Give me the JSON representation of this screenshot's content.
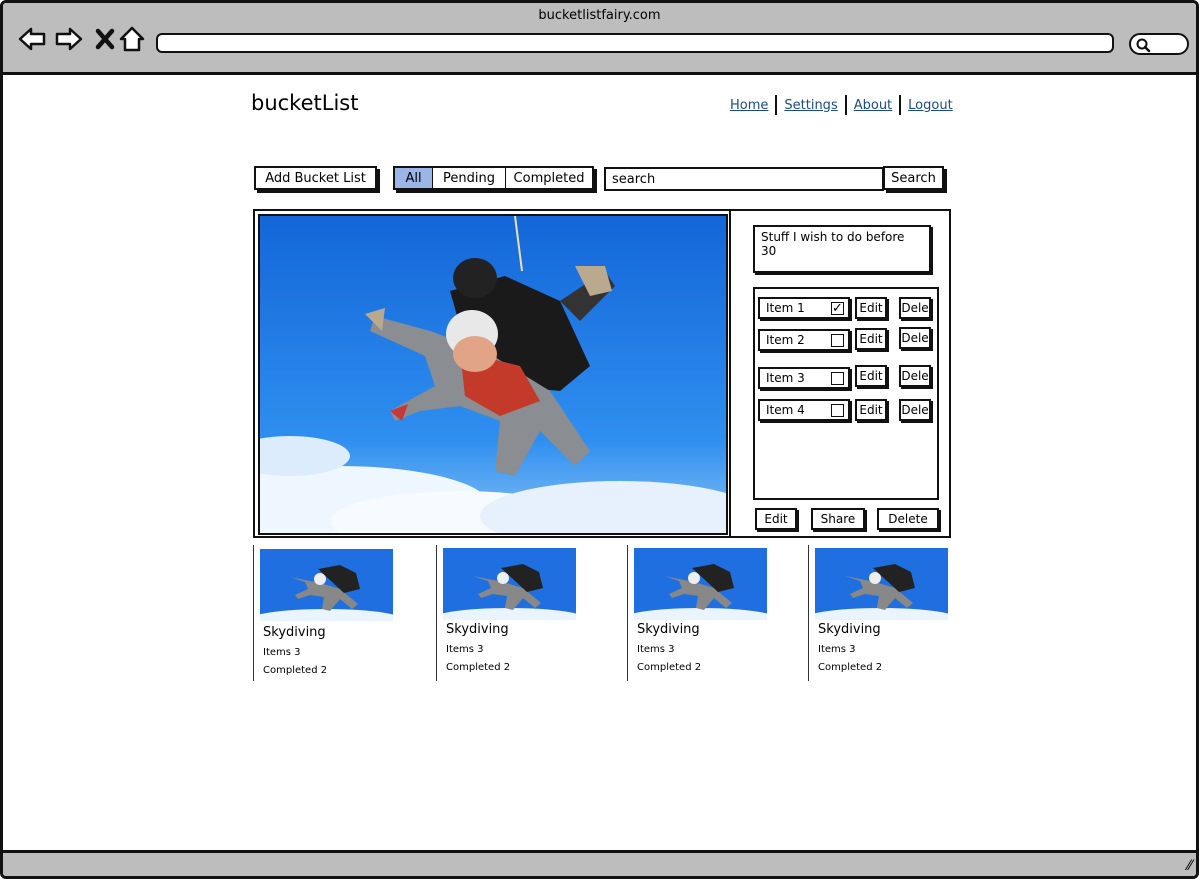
{
  "browser": {
    "title": "bucketlistfairy.com",
    "url": "",
    "icons": [
      "back-icon",
      "forward-icon",
      "close-icon",
      "home-icon",
      "search-icon"
    ]
  },
  "header": {
    "brand": "bucketList",
    "nav": [
      {
        "label": "Home"
      },
      {
        "label": "Settings"
      },
      {
        "label": "About"
      },
      {
        "label": "Logout"
      }
    ]
  },
  "toolbar": {
    "add_label": "Add Bucket List",
    "filters": [
      {
        "label": "All",
        "active": true
      },
      {
        "label": "Pending",
        "active": false
      },
      {
        "label": "Completed",
        "active": false
      }
    ],
    "search_value": "search",
    "search_button": "Search"
  },
  "detail": {
    "description": "Stuff I wish to do before 30",
    "items": [
      {
        "label": "Item 1",
        "checked": true,
        "edit": "Edit",
        "delete": "Dele"
      },
      {
        "label": "Item 2",
        "checked": false,
        "edit": "Edit",
        "delete": "Dele"
      },
      {
        "label": "Item 3",
        "checked": false,
        "edit": "Edit",
        "delete": "Dele"
      },
      {
        "label": "Item 4",
        "checked": false,
        "edit": "Edit",
        "delete": "Dele"
      }
    ],
    "actions": {
      "edit": "Edit",
      "share": "Share",
      "delete": "Delete"
    }
  },
  "cards": [
    {
      "title": "Skydiving",
      "items": "Items 3",
      "completed": "Completed 2"
    },
    {
      "title": "Skydiving",
      "items": "Items 3",
      "completed": "Completed 2"
    },
    {
      "title": "Skydiving",
      "items": "Items 3",
      "completed": "Completed 2"
    },
    {
      "title": "Skydiving",
      "items": "Items 3",
      "completed": "Completed 2"
    }
  ],
  "colors": {
    "chrome": "#bdbdbd",
    "active_filter": "#9ab5e6",
    "link": "#1a4a8a",
    "sky": "#1f6fe0"
  }
}
